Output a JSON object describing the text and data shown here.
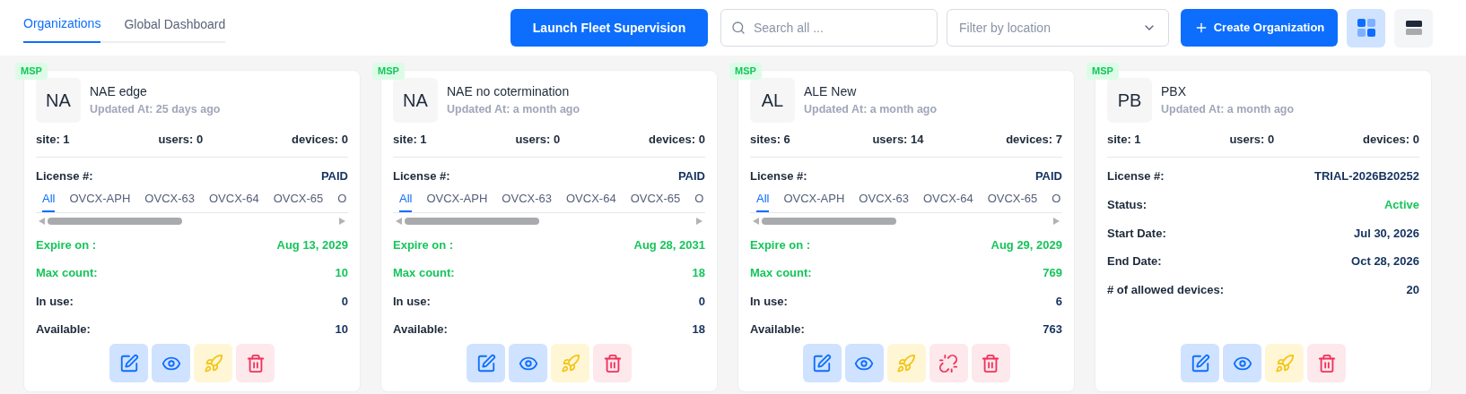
{
  "tabs": [
    {
      "label": "Organizations",
      "selected": true
    },
    {
      "label": "Global Dashboard",
      "selected": false
    }
  ],
  "launch_button": "Launch Fleet Supervision",
  "search": {
    "placeholder": "Search all ..."
  },
  "location_filter": {
    "placeholder": "Filter by location"
  },
  "create_button": "Create Organization",
  "view_toggle": [
    {
      "kind": "grid",
      "selected": true
    },
    {
      "kind": "list",
      "selected": false
    }
  ],
  "cards": [
    {
      "badge": "MSP",
      "initials": "NA",
      "name": "NAE edge",
      "updated": "Updated At: 25 days ago",
      "stats": [
        "site: 1",
        "users: 0",
        "devices: 0"
      ],
      "license_label": "License #:",
      "license_value": "PAID",
      "license_tabs": [
        {
          "label": "All",
          "selected": true
        },
        {
          "label": "OVCX-APH",
          "selected": false
        },
        {
          "label": "OVCX-63",
          "selected": false
        },
        {
          "label": "OVCX-64",
          "selected": false
        },
        {
          "label": "OVCX-65",
          "selected": false
        },
        {
          "label": "O",
          "selected": false
        }
      ],
      "rows": [
        {
          "kind": "highlight",
          "label": "Expire on :",
          "value": "Aug 13, 2029"
        },
        {
          "kind": "highlight",
          "label": "Max count:",
          "value": "10"
        },
        {
          "kind": "plain",
          "label": "In use:",
          "value": "0"
        },
        {
          "kind": "plain",
          "label": "Available:",
          "value": "10"
        }
      ],
      "actions": [
        {
          "kind": "edit"
        },
        {
          "kind": "view"
        },
        {
          "kind": "launch"
        },
        {
          "kind": "delete"
        }
      ]
    },
    {
      "badge": "MSP",
      "initials": "NA",
      "name": "NAE no cotermination",
      "updated": "Updated At: a month ago",
      "stats": [
        "site: 1",
        "users: 0",
        "devices: 0"
      ],
      "license_label": "License #:",
      "license_value": "PAID",
      "license_tabs": [
        {
          "label": "All",
          "selected": true
        },
        {
          "label": "OVCX-APH",
          "selected": false
        },
        {
          "label": "OVCX-63",
          "selected": false
        },
        {
          "label": "OVCX-64",
          "selected": false
        },
        {
          "label": "OVCX-65",
          "selected": false
        },
        {
          "label": "O",
          "selected": false
        }
      ],
      "rows": [
        {
          "kind": "highlight",
          "label": "Expire on :",
          "value": "Aug 28, 2031"
        },
        {
          "kind": "highlight",
          "label": "Max count:",
          "value": "18"
        },
        {
          "kind": "plain",
          "label": "In use:",
          "value": "0"
        },
        {
          "kind": "plain",
          "label": "Available:",
          "value": "18"
        }
      ],
      "actions": [
        {
          "kind": "edit"
        },
        {
          "kind": "view"
        },
        {
          "kind": "launch"
        },
        {
          "kind": "delete"
        }
      ]
    },
    {
      "badge": "MSP",
      "initials": "AL",
      "name": "ALE New",
      "updated": "Updated At: a month ago",
      "stats": [
        "sites: 6",
        "users: 14",
        "devices: 7"
      ],
      "license_label": "License #:",
      "license_value": "PAID",
      "license_tabs": [
        {
          "label": "All",
          "selected": true
        },
        {
          "label": "OVCX-APH",
          "selected": false
        },
        {
          "label": "OVCX-63",
          "selected": false
        },
        {
          "label": "OVCX-64",
          "selected": false
        },
        {
          "label": "OVCX-65",
          "selected": false
        },
        {
          "label": "O",
          "selected": false
        }
      ],
      "rows": [
        {
          "kind": "highlight",
          "label": "Expire on :",
          "value": "Aug 29, 2029"
        },
        {
          "kind": "highlight",
          "label": "Max count:",
          "value": "769"
        },
        {
          "kind": "plain",
          "label": "In use:",
          "value": "6"
        },
        {
          "kind": "plain",
          "label": "Available:",
          "value": "763"
        }
      ],
      "actions": [
        {
          "kind": "edit"
        },
        {
          "kind": "view"
        },
        {
          "kind": "launch"
        },
        {
          "kind": "unlink"
        },
        {
          "kind": "delete"
        }
      ]
    },
    {
      "badge": "MSP",
      "initials": "PB",
      "name": "PBX",
      "updated": "Updated At: a month ago",
      "stats": [
        "site: 1",
        "users: 0",
        "devices: 0"
      ],
      "license_label": "License #:",
      "license_value": "TRIAL-2026B20252",
      "rows": [
        {
          "kind": "status",
          "label": "Status:",
          "value": "Active"
        },
        {
          "kind": "plain",
          "label": "Start Date:",
          "value": "Jul 30, 2026"
        },
        {
          "kind": "plain",
          "label": "End Date:",
          "value": "Oct 28, 2026"
        },
        {
          "kind": "plain",
          "label": "# of allowed devices:",
          "value": "20"
        }
      ],
      "actions": [
        {
          "kind": "edit"
        },
        {
          "kind": "view"
        },
        {
          "kind": "launch"
        },
        {
          "kind": "delete"
        }
      ]
    }
  ]
}
